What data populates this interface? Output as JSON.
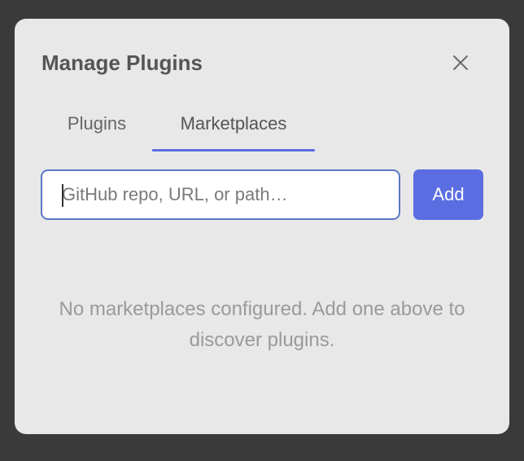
{
  "dialog": {
    "title": "Manage Plugins",
    "close_icon": "close-icon"
  },
  "tabs": [
    {
      "label": "Plugins",
      "active": false
    },
    {
      "label": "Marketplaces",
      "active": true
    }
  ],
  "marketplace_form": {
    "input_value": "",
    "input_placeholder": "GitHub repo, URL, or path…",
    "add_label": "Add"
  },
  "empty_state": {
    "message": "No marketplaces configured. Add one above to discover plugins."
  },
  "colors": {
    "accent": "#5b6ee1",
    "input_border": "#5b79c4",
    "dialog_background": "#e8e8e8",
    "backdrop": "#3a3a3a"
  }
}
